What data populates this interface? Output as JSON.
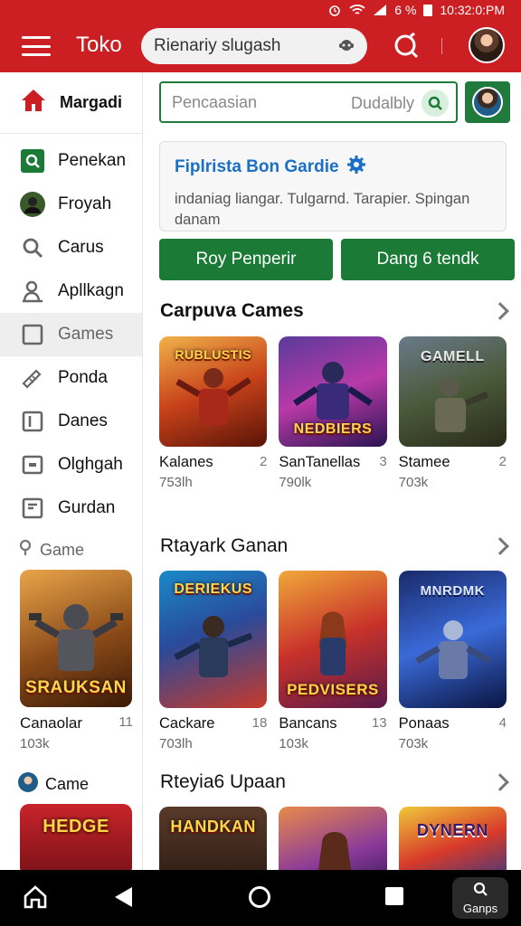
{
  "status": {
    "battery": "6 %",
    "time": "10:32:0:PM"
  },
  "appbar": {
    "title": "Toko",
    "search_placeholder": "Rienariy slugash"
  },
  "sidebar": {
    "header": "Margadi",
    "items": [
      {
        "label": "Penekan",
        "icon": "search-square-icon"
      },
      {
        "label": "Froyah",
        "icon": "avatar-icon"
      },
      {
        "label": "Carus",
        "icon": "search-icon"
      },
      {
        "label": "Apllkagn",
        "icon": "person-pin-icon"
      },
      {
        "label": "Games",
        "icon": "square-icon",
        "active": true
      },
      {
        "label": "Ponda",
        "icon": "tag-icon"
      },
      {
        "label": "Danes",
        "icon": "box-icon"
      },
      {
        "label": "Olghgah",
        "icon": "card-icon"
      },
      {
        "label": "Gurdan",
        "icon": "doc-icon"
      }
    ],
    "section1": "Game",
    "card1": {
      "caption": "SRAUKSAN",
      "name": "Canaolar",
      "count": "11",
      "sub": "103k"
    },
    "section2": "Came",
    "card2": {
      "caption": "HEDGE"
    }
  },
  "main": {
    "search": {
      "placeholder": "Pencaasian",
      "right_text": "Dudalbly"
    },
    "info": {
      "title": "Fiplrista Bon Gardie",
      "desc": "indaniag liangar. Tulgarnd. Tarapier. Spingan danam"
    },
    "buttons": {
      "left": "Roy Penperir",
      "right": "Dang 6 tendk"
    },
    "section1": {
      "title": "Carpuva Cames",
      "tiles": [
        {
          "name": "Kalanes",
          "count": "2",
          "sub": "753lh",
          "caption": "RUBLUSTIS"
        },
        {
          "name": "SanTanellas",
          "count": "3",
          "sub": "790lk",
          "caption": "NEDBIERS"
        },
        {
          "name": "Stamee",
          "count": "2",
          "sub": "703k",
          "caption": "GAMELL"
        }
      ]
    },
    "section2": {
      "title": "Rtayark Ganan",
      "tiles": [
        {
          "name": "Cackare",
          "count": "18",
          "sub": "703lh",
          "caption": "DERIEKUS"
        },
        {
          "name": "Bancans",
          "count": "13",
          "sub": "103k",
          "caption": "PEDVISERS"
        },
        {
          "name": "Ponaas",
          "count": "4",
          "sub": "703k",
          "caption": "MNRDMK"
        }
      ]
    },
    "section3": {
      "title": "Rteyia6 Upaan",
      "tiles": [
        {
          "caption": "HANDKAN"
        },
        {
          "caption": ""
        },
        {
          "caption": "DYNERN"
        }
      ]
    }
  },
  "navbar": {
    "games_label": "Ganps"
  },
  "colors": {
    "brand_red": "#cc1f24",
    "brand_green": "#1a7a36",
    "link_blue": "#1b6fc4"
  }
}
